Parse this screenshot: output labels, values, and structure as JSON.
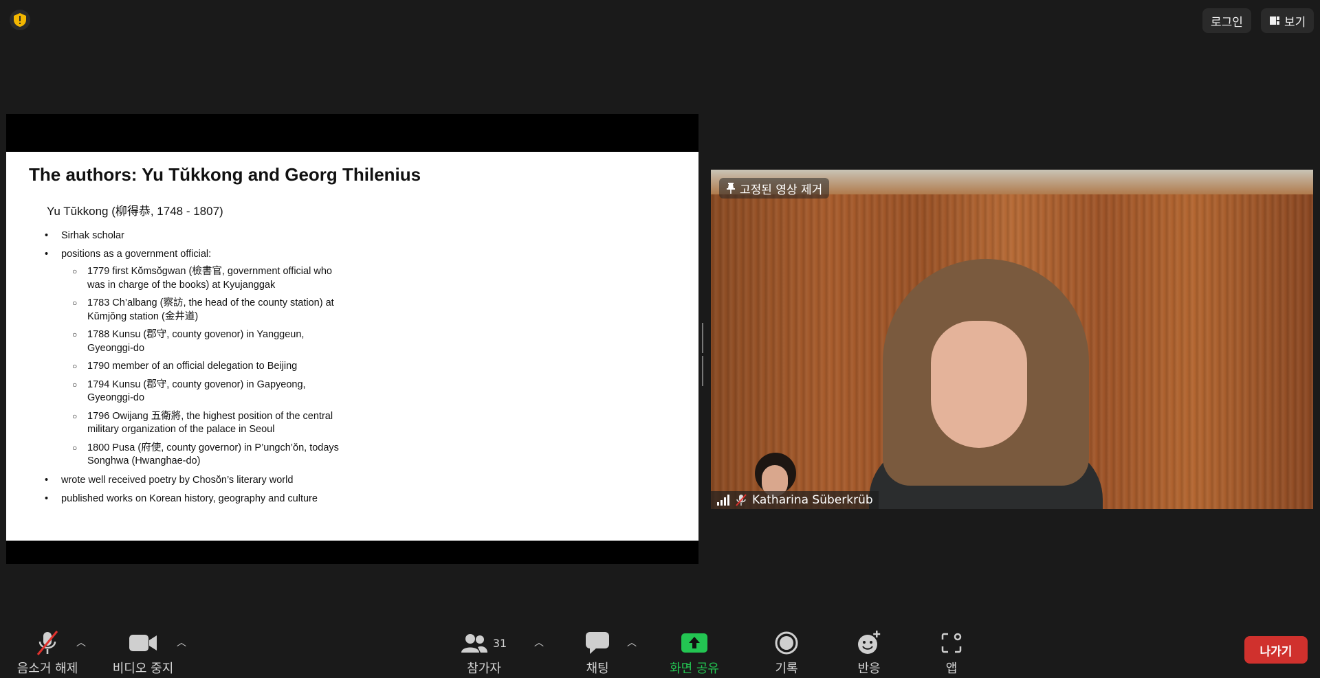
{
  "top_bar": {
    "security_icon": "shield-warning-icon",
    "login_label": "로그인",
    "view_label": "보기"
  },
  "slide": {
    "title": "The authors: Yu Tŭkkong and Georg Thilenius",
    "subtitle": "Yu Tŭkkong (柳得恭, 1748 - 1807)",
    "bullets": [
      "Sirhak scholar",
      "positions as a government official:",
      "wrote well received poetry by Chosŏn’s literary world",
      "published works on Korean history, geography and culture"
    ],
    "sub_bullets": [
      "1779 first Kŏmsŏgwan (檢書官, government official who was in charge of the books) at Kyujanggak",
      "1783 Ch’albang (察訪, the head of the county station) at Kŭmjŏng station (金井道)",
      "1788 Kunsu (郡守, county govenor) in Yanggeun, Gyeonggi-do",
      "1790 member of an official delegation to Beijing",
      "1794 Kunsu (郡守, county govenor) in Gapyeong, Gyeonggi-do",
      "1796 Owijang 五衛將, the highest position of the central military organization of the palace in Seoul",
      "1800 Pusa (府使, county governor) in P’ungch’ŏn, todays Songhwa (Hwanghae-do)"
    ]
  },
  "video": {
    "pin_label": "고정된 영상 제거",
    "participant_name": "Katharina Süberkrüb"
  },
  "toolbar": {
    "mute_label": "음소거 해제",
    "video_label": "비디오 중지",
    "participants_label": "참가자",
    "participants_count": "31",
    "chat_label": "채팅",
    "share_label": "화면 공유",
    "record_label": "기록",
    "reactions_label": "반응",
    "apps_label": "앱",
    "leave_label": "나가기"
  },
  "colors": {
    "background": "#1a1a1a",
    "share_green": "#23c552",
    "leave_red": "#d0312d",
    "security_yellow": "#f2b600"
  }
}
